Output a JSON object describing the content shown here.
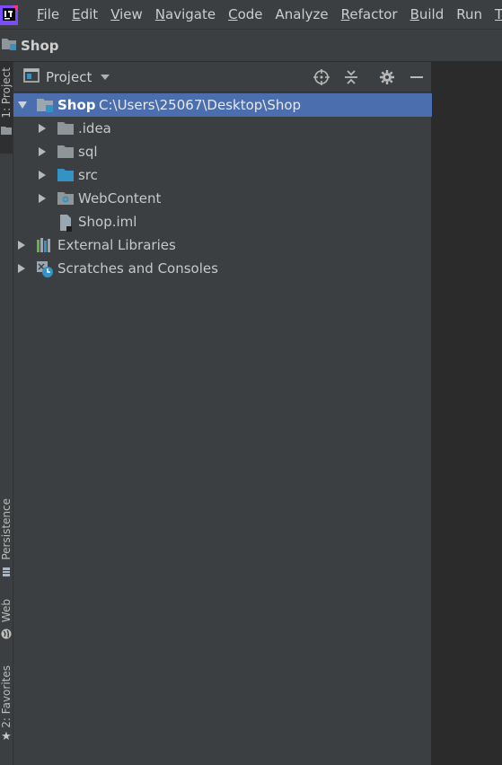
{
  "menubar": {
    "items": [
      {
        "mnemonic": "F",
        "rest": "ile"
      },
      {
        "mnemonic": "E",
        "rest": "dit"
      },
      {
        "mnemonic": "V",
        "rest": "iew"
      },
      {
        "mnemonic": "N",
        "rest": "avigate"
      },
      {
        "mnemonic": "C",
        "rest": "ode"
      },
      {
        "mnemonic": "",
        "rest": "Analyze"
      },
      {
        "mnemonic": "R",
        "rest": "efactor"
      },
      {
        "mnemonic": "B",
        "rest": "uild"
      },
      {
        "mnemonic": "",
        "rest": "Run"
      },
      {
        "mnemonic": "T",
        "rest": ""
      }
    ]
  },
  "navbar": {
    "project_name": "Shop"
  },
  "leftstrip": {
    "project_tab": "1: Project",
    "persistence_tab": "Persistence",
    "web_tab": "Web",
    "favorites_tab": "2: Favorites"
  },
  "panel": {
    "title": "Project",
    "icons": [
      "locate-icon",
      "collapse-all-icon",
      "gear-icon",
      "minimize-icon"
    ]
  },
  "tree": {
    "root": {
      "name": "Shop",
      "path": "C:\\Users\\25067\\Desktop\\Shop"
    },
    "children": [
      {
        "label": ".idea",
        "icon": "folder-gray-icon"
      },
      {
        "label": "sql",
        "icon": "folder-gray-icon"
      },
      {
        "label": "src",
        "icon": "folder-blue-icon"
      },
      {
        "label": "WebContent",
        "icon": "web-folder-icon"
      },
      {
        "label": "Shop.iml",
        "icon": "iml-file-icon"
      }
    ],
    "external_libraries": "External Libraries",
    "scratches": "Scratches and Consoles"
  },
  "colors": {
    "menubar_bg": "#3c3f41",
    "editor_bg": "#2b2b2b",
    "selection": "#4b6eaf",
    "folder_blue": "#3592c4",
    "folder_gray": "#8e9699"
  }
}
